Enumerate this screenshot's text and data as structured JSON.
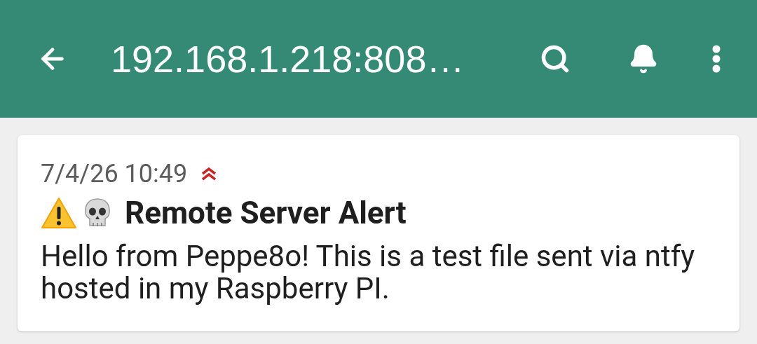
{
  "app_bar": {
    "title": "192.168.1.218:808…"
  },
  "notifications": [
    {
      "time": "7/4/26 10:49",
      "priority": {
        "kind": "high"
      },
      "tags": [
        {
          "kind": "warning"
        },
        {
          "kind": "skull"
        }
      ],
      "title": "Remote Server Alert",
      "message": "Hello from Peppe8o! This is a test file sent via ntfy hosted in my Raspberry PI."
    }
  ]
}
